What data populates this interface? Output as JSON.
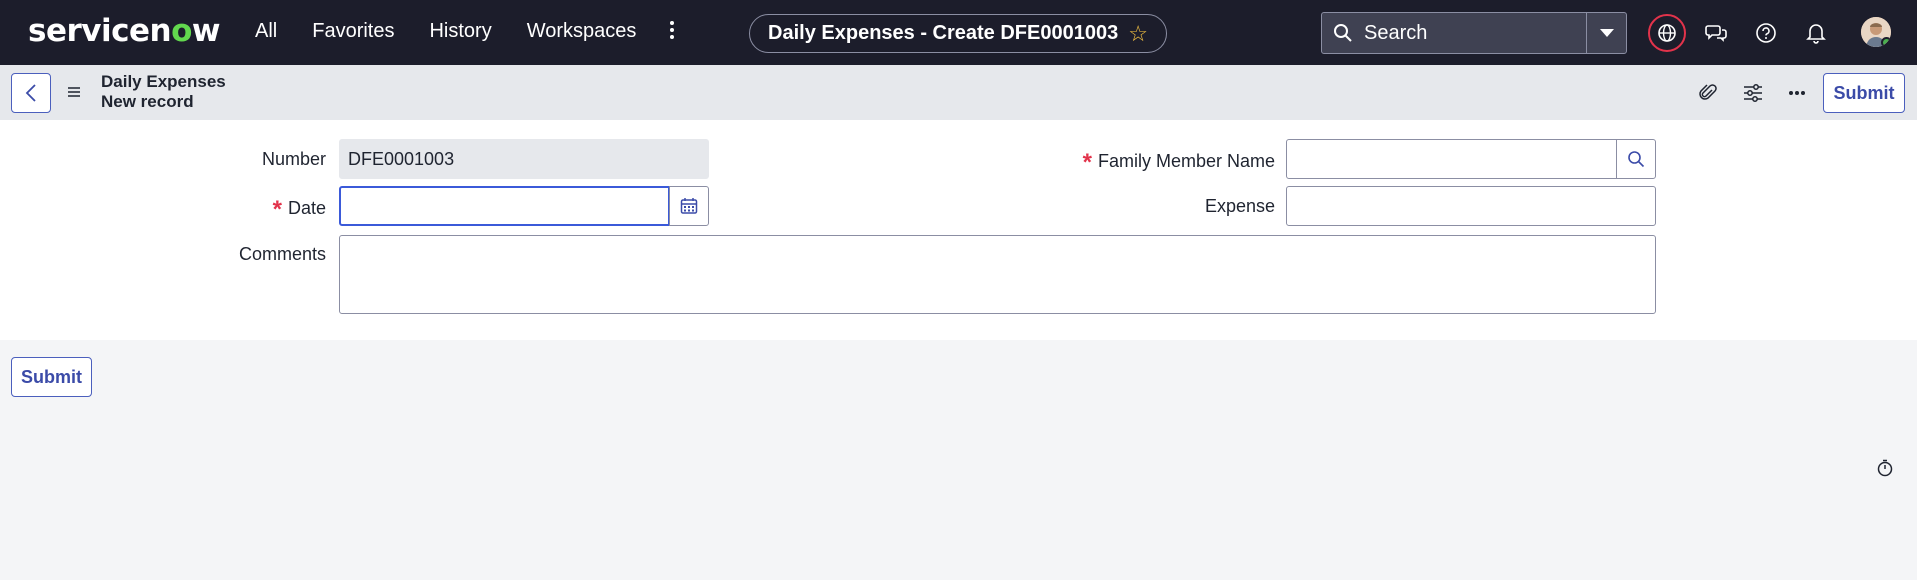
{
  "app": {
    "logo_text": "servicenow"
  },
  "topnav": {
    "links": [
      "All",
      "Favorites",
      "History",
      "Workspaces"
    ],
    "title": "Daily Expenses - Create DFE0001003",
    "search_placeholder": "Search",
    "icons": [
      "globe-icon",
      "chat-icon",
      "help-icon",
      "bell-icon",
      "avatar"
    ]
  },
  "header": {
    "line1": "Daily Expenses",
    "line2": "New record",
    "submit_label": "Submit"
  },
  "form": {
    "number_label": "Number",
    "number_value": "DFE0001003",
    "date_label": "Date",
    "date_value": "",
    "comments_label": "Comments",
    "comments_value": "",
    "family_label": "Family Member Name",
    "family_value": "",
    "expense_label": "Expense",
    "expense_value": ""
  },
  "footer": {
    "submit_label": "Submit"
  },
  "colors": {
    "nav_bg": "#1c1d2b",
    "accent": "#3b4ba8",
    "required": "#e2334b",
    "focus": "#3b5ad9"
  }
}
